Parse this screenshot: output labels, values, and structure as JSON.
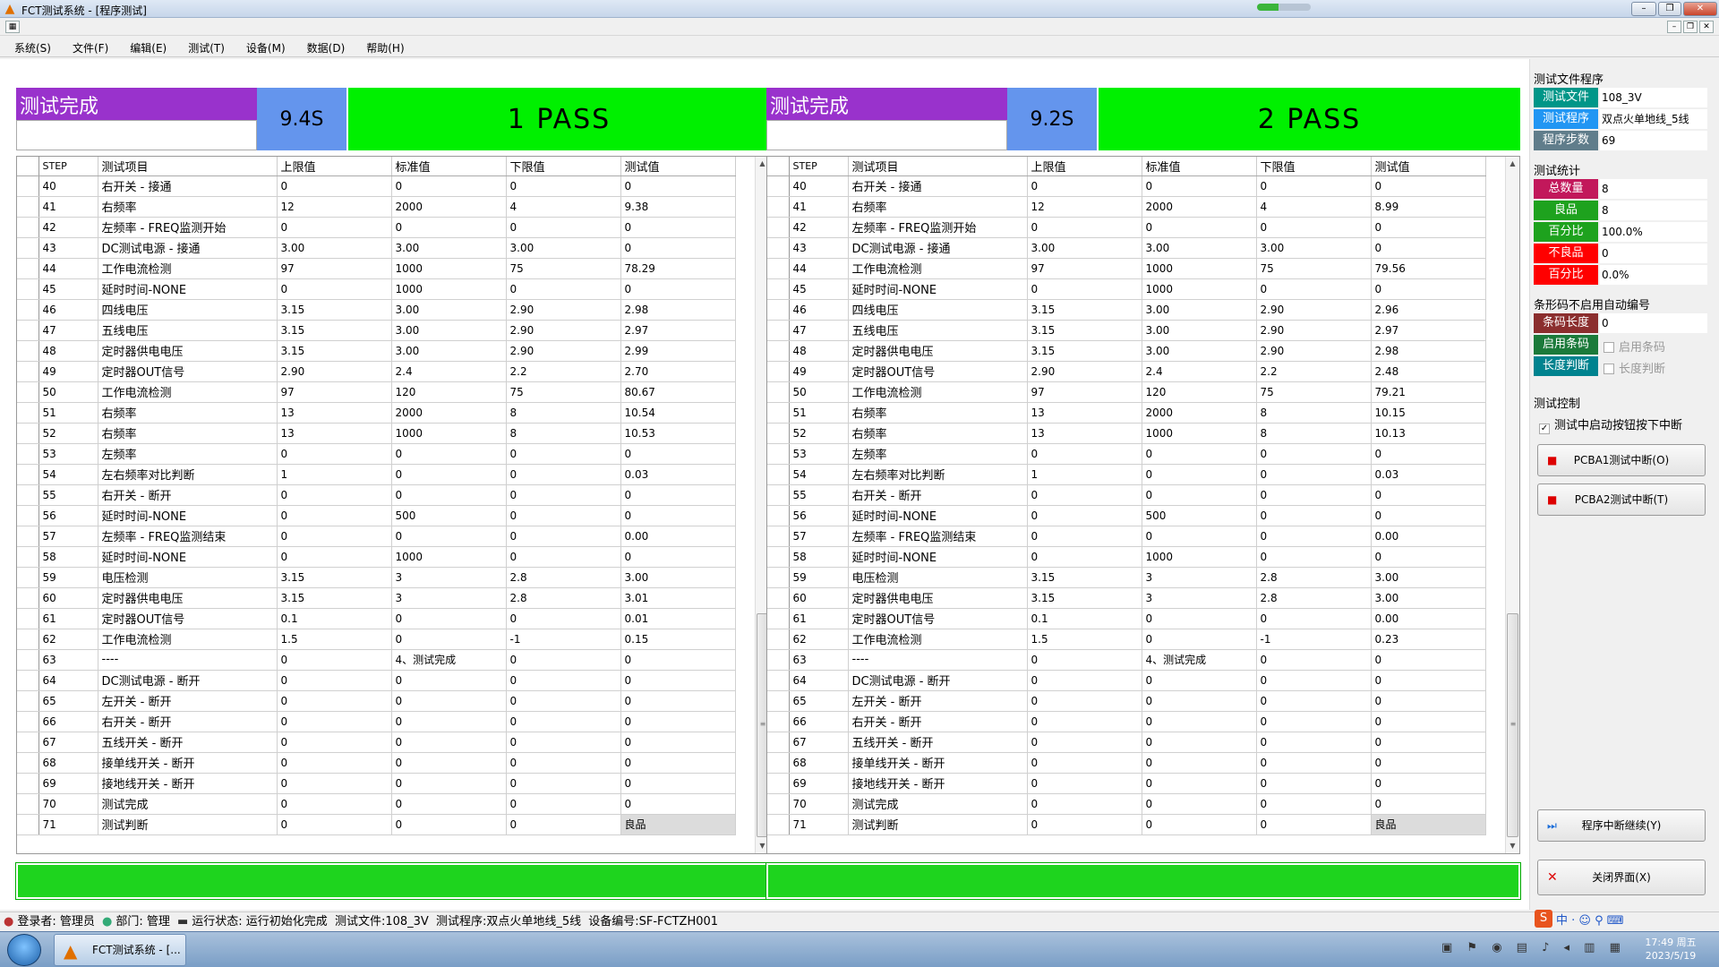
{
  "window": {
    "title": "FCT测试系统 - [程序测试]"
  },
  "menu": [
    "系统(S)",
    "文件(F)",
    "编辑(E)",
    "测试(T)",
    "设备(M)",
    "数据(D)",
    "帮助(H)"
  ],
  "stations": [
    {
      "status": "测试完成",
      "time": "9.4S",
      "result": "1  PASS"
    },
    {
      "status": "测试完成",
      "time": "9.2S",
      "result": "2  PASS"
    }
  ],
  "grid_headers": [
    "STEP",
    "测试项目",
    "上限值",
    "标准值",
    "下限值",
    "测试值"
  ],
  "grid_rows": [
    [
      [
        "40",
        "右开关 - 接通",
        "0",
        "0",
        "0",
        "0"
      ],
      [
        "41",
        "右频率",
        "12",
        "2000",
        "4",
        "9.38"
      ],
      [
        "42",
        "左频率 - FREQ监测开始",
        "0",
        "0",
        "0",
        "0"
      ],
      [
        "43",
        "DC测试电源 - 接通",
        "3.00",
        "3.00",
        "3.00",
        "0"
      ],
      [
        "44",
        "工作电流检测",
        "97",
        "1000",
        "75",
        "78.29"
      ],
      [
        "45",
        "延时时间-NONE",
        "0",
        "1000",
        "0",
        "0"
      ],
      [
        "46",
        "四线电压",
        "3.15",
        "3.00",
        "2.90",
        "2.98"
      ],
      [
        "47",
        "五线电压",
        "3.15",
        "3.00",
        "2.90",
        "2.97"
      ],
      [
        "48",
        "定时器供电电压",
        "3.15",
        "3.00",
        "2.90",
        "2.99"
      ],
      [
        "49",
        "定时器OUT信号",
        "2.90",
        "2.4",
        "2.2",
        "2.70"
      ],
      [
        "50",
        "工作电流检测",
        "97",
        "120",
        "75",
        "80.67"
      ],
      [
        "51",
        "右频率",
        "13",
        "2000",
        "8",
        "10.54"
      ],
      [
        "52",
        "右频率",
        "13",
        "1000",
        "8",
        "10.53"
      ],
      [
        "53",
        "左频率",
        "0",
        "0",
        "0",
        "0"
      ],
      [
        "54",
        "左右频率对比判断",
        "1",
        "0",
        "0",
        "0.03"
      ],
      [
        "55",
        "右开关 - 断开",
        "0",
        "0",
        "0",
        "0"
      ],
      [
        "56",
        "延时时间-NONE",
        "0",
        "500",
        "0",
        "0"
      ],
      [
        "57",
        "左频率 - FREQ监测结束",
        "0",
        "0",
        "0",
        "0.00"
      ],
      [
        "58",
        "延时时间-NONE",
        "0",
        "1000",
        "0",
        "0"
      ],
      [
        "59",
        "电压检测",
        "3.15",
        "3",
        "2.8",
        "3.00"
      ],
      [
        "60",
        "定时器供电电压",
        "3.15",
        "3",
        "2.8",
        "3.01"
      ],
      [
        "61",
        "定时器OUT信号",
        "0.1",
        "0",
        "0",
        "0.01"
      ],
      [
        "62",
        "工作电流检测",
        "1.5",
        "0",
        "-1",
        "0.15"
      ],
      [
        "63",
        "----",
        "0",
        "4、测试完成",
        "0",
        "0"
      ],
      [
        "64",
        "DC测试电源 - 断开",
        "0",
        "0",
        "0",
        "0"
      ],
      [
        "65",
        "左开关 - 断开",
        "0",
        "0",
        "0",
        "0"
      ],
      [
        "66",
        "右开关 - 断开",
        "0",
        "0",
        "0",
        "0"
      ],
      [
        "67",
        "五线开关 - 断开",
        "0",
        "0",
        "0",
        "0"
      ],
      [
        "68",
        "接单线开关 - 断开",
        "0",
        "0",
        "0",
        "0"
      ],
      [
        "69",
        "接地线开关 - 断开",
        "0",
        "0",
        "0",
        "0"
      ],
      [
        "70",
        "测试完成",
        "0",
        "0",
        "0",
        "0"
      ],
      [
        "71",
        "测试判断",
        "0",
        "0",
        "0",
        "良品"
      ]
    ],
    [
      [
        "40",
        "右开关 - 接通",
        "0",
        "0",
        "0",
        "0"
      ],
      [
        "41",
        "右频率",
        "12",
        "2000",
        "4",
        "8.99"
      ],
      [
        "42",
        "左频率 - FREQ监测开始",
        "0",
        "0",
        "0",
        "0"
      ],
      [
        "43",
        "DC测试电源 - 接通",
        "3.00",
        "3.00",
        "3.00",
        "0"
      ],
      [
        "44",
        "工作电流检测",
        "97",
        "1000",
        "75",
        "79.56"
      ],
      [
        "45",
        "延时时间-NONE",
        "0",
        "1000",
        "0",
        "0"
      ],
      [
        "46",
        "四线电压",
        "3.15",
        "3.00",
        "2.90",
        "2.96"
      ],
      [
        "47",
        "五线电压",
        "3.15",
        "3.00",
        "2.90",
        "2.97"
      ],
      [
        "48",
        "定时器供电电压",
        "3.15",
        "3.00",
        "2.90",
        "2.98"
      ],
      [
        "49",
        "定时器OUT信号",
        "2.90",
        "2.4",
        "2.2",
        "2.48"
      ],
      [
        "50",
        "工作电流检测",
        "97",
        "120",
        "75",
        "79.21"
      ],
      [
        "51",
        "右频率",
        "13",
        "2000",
        "8",
        "10.15"
      ],
      [
        "52",
        "右频率",
        "13",
        "1000",
        "8",
        "10.13"
      ],
      [
        "53",
        "左频率",
        "0",
        "0",
        "0",
        "0"
      ],
      [
        "54",
        "左右频率对比判断",
        "1",
        "0",
        "0",
        "0.03"
      ],
      [
        "55",
        "右开关 - 断开",
        "0",
        "0",
        "0",
        "0"
      ],
      [
        "56",
        "延时时间-NONE",
        "0",
        "500",
        "0",
        "0"
      ],
      [
        "57",
        "左频率 - FREQ监测结束",
        "0",
        "0",
        "0",
        "0.00"
      ],
      [
        "58",
        "延时时间-NONE",
        "0",
        "1000",
        "0",
        "0"
      ],
      [
        "59",
        "电压检测",
        "3.15",
        "3",
        "2.8",
        "3.00"
      ],
      [
        "60",
        "定时器供电电压",
        "3.15",
        "3",
        "2.8",
        "3.00"
      ],
      [
        "61",
        "定时器OUT信号",
        "0.1",
        "0",
        "0",
        "0.00"
      ],
      [
        "62",
        "工作电流检测",
        "1.5",
        "0",
        "-1",
        "0.23"
      ],
      [
        "63",
        "----",
        "0",
        "4、测试完成",
        "0",
        "0"
      ],
      [
        "64",
        "DC测试电源 - 断开",
        "0",
        "0",
        "0",
        "0"
      ],
      [
        "65",
        "左开关 - 断开",
        "0",
        "0",
        "0",
        "0"
      ],
      [
        "66",
        "右开关 - 断开",
        "0",
        "0",
        "0",
        "0"
      ],
      [
        "67",
        "五线开关 - 断开",
        "0",
        "0",
        "0",
        "0"
      ],
      [
        "68",
        "接单线开关 - 断开",
        "0",
        "0",
        "0",
        "0"
      ],
      [
        "69",
        "接地线开关 - 断开",
        "0",
        "0",
        "0",
        "0"
      ],
      [
        "70",
        "测试完成",
        "0",
        "0",
        "0",
        "0"
      ],
      [
        "71",
        "测试判断",
        "0",
        "0",
        "0",
        "良品"
      ]
    ]
  ],
  "sidebar": {
    "file_section": "测试文件程序",
    "file_label": "测试文件",
    "file_value": "108_3V",
    "program_label": "测试程序",
    "program_value": "双点火单地线_5线",
    "steps_label": "程序步数",
    "steps_value": "69",
    "stats_section": "测试统计",
    "total_label": "总数量",
    "total_value": "8",
    "good_label": "良品",
    "good_value": "8",
    "good_pct_label": "百分比",
    "good_pct_value": "100.0%",
    "bad_label": "不良品",
    "bad_value": "0",
    "bad_pct_label": "百分比",
    "bad_pct_value": "0.0%",
    "barcode_section": "条形码不启用自动编号",
    "barcode_len_label": "条码长度",
    "barcode_len_value": "0",
    "enable_barcode_label": "启用条码",
    "enable_barcode_check": "启用条码",
    "len_check_label": "长度判断",
    "len_check_check": "长度判断",
    "control_section": "测试控制",
    "interrupt_check": "测试中启动按钮按下中断",
    "pcba1_button": "PCBA1测试中断(O)",
    "pcba2_button": "PCBA2测试中断(T)",
    "resume_button": "程序中断继续(Y)",
    "close_button": "关闭界面(X)"
  },
  "statusbar": {
    "user": "登录者: 管理员",
    "dept": "部门: 管理",
    "state": "运行状态: 运行初始化完成",
    "file": "测试文件:108_3V",
    "program": "测试程序:双点火单地线_5线",
    "device": "设备编号:SF-FCTZH001"
  },
  "taskbar": {
    "app": "FCT测试系统 - [...",
    "time": "17:49 周五",
    "date": "2023/5/19"
  },
  "colors": {
    "pass": "#00f000",
    "status": "#9932cc",
    "time": "#6495ed",
    "bottom_bar": "#1ed41e"
  }
}
